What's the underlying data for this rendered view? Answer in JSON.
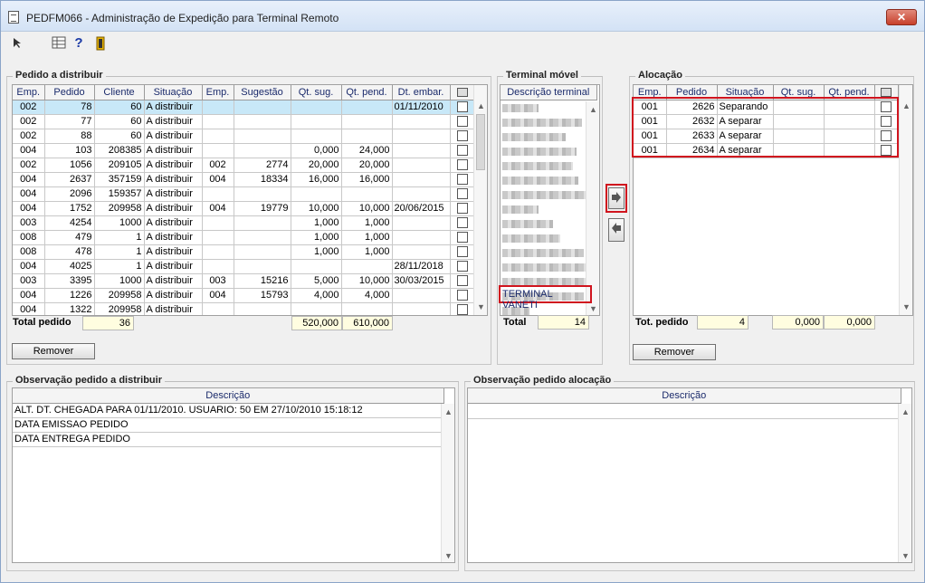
{
  "window": {
    "title": "PEDFM066 - Administração de Expedição para Terminal Remoto",
    "close_label": "✕"
  },
  "toolbar": {
    "help_label": "?"
  },
  "pedido": {
    "title": "Pedido a distribuir",
    "headers": [
      "Emp.",
      "Pedido",
      "Cliente",
      "Situação",
      "Emp.",
      "Sugestão",
      "Qt. sug.",
      "Qt. pend.",
      "Dt. embar."
    ],
    "rows": [
      [
        "002",
        "78",
        "60",
        "A distribuir",
        "",
        "",
        "",
        "",
        "01/11/2010"
      ],
      [
        "002",
        "77",
        "60",
        "A distribuir",
        "",
        "",
        "",
        "",
        ""
      ],
      [
        "002",
        "88",
        "60",
        "A distribuir",
        "",
        "",
        "",
        "",
        ""
      ],
      [
        "004",
        "103",
        "208385",
        "A distribuir",
        "",
        "",
        "0,000",
        "24,000",
        ""
      ],
      [
        "002",
        "1056",
        "209105",
        "A distribuir",
        "002",
        "2774",
        "20,000",
        "20,000",
        ""
      ],
      [
        "004",
        "2637",
        "357159",
        "A distribuir",
        "004",
        "18334",
        "16,000",
        "16,000",
        ""
      ],
      [
        "004",
        "2096",
        "159357",
        "A distribuir",
        "",
        "",
        "",
        "",
        ""
      ],
      [
        "004",
        "1752",
        "209958",
        "A distribuir",
        "004",
        "19779",
        "10,000",
        "10,000",
        "20/06/2015"
      ],
      [
        "003",
        "4254",
        "1000",
        "A distribuir",
        "",
        "",
        "1,000",
        "1,000",
        ""
      ],
      [
        "008",
        "479",
        "1",
        "A distribuir",
        "",
        "",
        "1,000",
        "1,000",
        ""
      ],
      [
        "008",
        "478",
        "1",
        "A distribuir",
        "",
        "",
        "1,000",
        "1,000",
        ""
      ],
      [
        "004",
        "4025",
        "1",
        "A distribuir",
        "",
        "",
        "",
        "",
        "28/11/2018"
      ],
      [
        "003",
        "3395",
        "1000",
        "A distribuir",
        "003",
        "15216",
        "5,000",
        "10,000",
        "30/03/2015"
      ],
      [
        "004",
        "1226",
        "209958",
        "A distribuir",
        "004",
        "15793",
        "4,000",
        "4,000",
        ""
      ],
      [
        "004",
        "1322",
        "209958",
        "A distribuir",
        "",
        "",
        "",
        "",
        ""
      ]
    ],
    "total_label": "Total pedido",
    "total_count": "36",
    "total_qt_sug": "520,000",
    "total_qt_pend": "610,000",
    "remove_label": "Remover"
  },
  "terminal": {
    "title": "Terminal móvel",
    "header": "Descrição terminal",
    "selected_terminal": "TERMINAL VANETI",
    "total_label": "Total",
    "total_count": "14"
  },
  "transfer": {
    "right_icon": "arrow-right-icon",
    "left_icon": "arrow-left-icon"
  },
  "alocacao": {
    "title": "Alocação",
    "headers": [
      "Emp.",
      "Pedido",
      "Situação",
      "Qt. sug.",
      "Qt. pend."
    ],
    "rows": [
      [
        "001",
        "2626",
        "Separando",
        "",
        ""
      ],
      [
        "001",
        "2632",
        "A separar",
        "",
        ""
      ],
      [
        "001",
        "2633",
        "A separar",
        "",
        ""
      ],
      [
        "001",
        "2634",
        "A separar",
        "",
        ""
      ]
    ],
    "total_label": "Tot. pedido",
    "total_count": "4",
    "total_qt_sug": "0,000",
    "total_qt_pend": "0,000",
    "remove_label": "Remover"
  },
  "obs_pedido": {
    "title": "Observação pedido a distribuir",
    "header": "Descrição",
    "rows": [
      "ALT. DT. CHEGADA  PARA 01/11/2010. USUARIO: 50 EM 27/10/2010 15:18:12",
      "DATA EMISSAO PEDIDO",
      "DATA ENTREGA PEDIDO"
    ]
  },
  "obs_alocacao": {
    "title": "Observação pedido alocação",
    "header": "Descrição"
  },
  "colors": {
    "selected_row": "#c8e8f8",
    "highlight": "#d0141e",
    "total_bg": "#fffde0"
  }
}
